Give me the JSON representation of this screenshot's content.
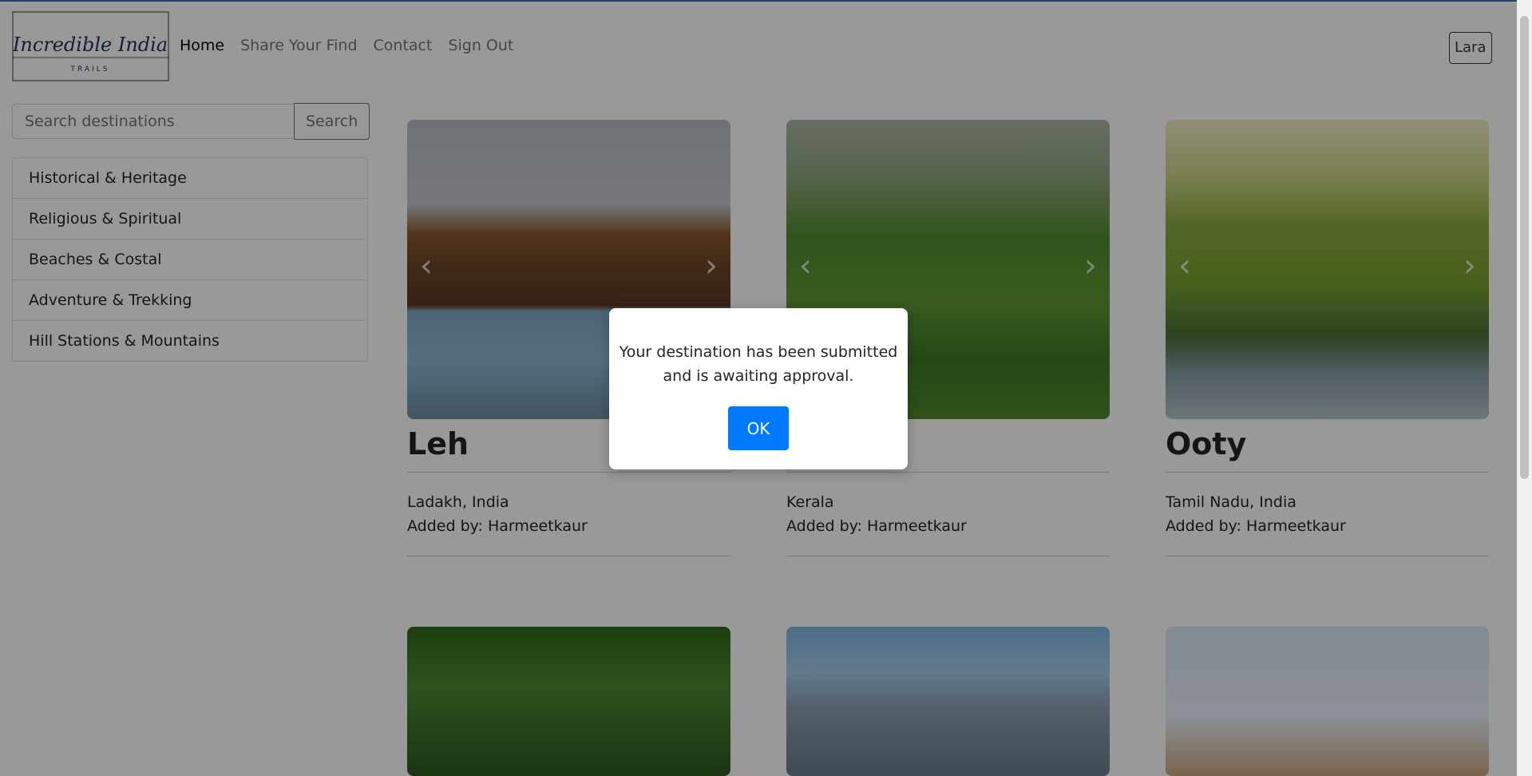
{
  "brand": {
    "logo_script": "Incredible India",
    "logo_sub": "TRAILS"
  },
  "nav": {
    "items": [
      {
        "label": "Home",
        "active": true
      },
      {
        "label": "Share Your Find",
        "active": false
      },
      {
        "label": "Contact",
        "active": false
      },
      {
        "label": "Sign Out",
        "active": false
      }
    ]
  },
  "user": {
    "label": "Lara"
  },
  "search": {
    "placeholder": "Search destinations",
    "button": "Search"
  },
  "categories": [
    "Historical & Heritage",
    "Religious & Spiritual",
    "Beaches & Costal",
    "Adventure & Trekking",
    "Hill Stations & Mountains"
  ],
  "cards": [
    {
      "title": "Leh",
      "location": "Ladakh, India",
      "added_by": "Added by: Harmeetkaur"
    },
    {
      "title": "",
      "location": "Kerala",
      "added_by": "Added by: Harmeetkaur"
    },
    {
      "title": "Ooty",
      "location": "Tamil Nadu, India",
      "added_by": "Added by: Harmeetkaur"
    }
  ],
  "carousel": {
    "prev_icon": "‹",
    "next_icon": "›"
  },
  "modal": {
    "line1": "Your destination has been submitted",
    "line2": "and is awaiting approval.",
    "ok": "OK"
  },
  "colors": {
    "primary": "#007bff",
    "top_accent": "#3b6fb6"
  }
}
